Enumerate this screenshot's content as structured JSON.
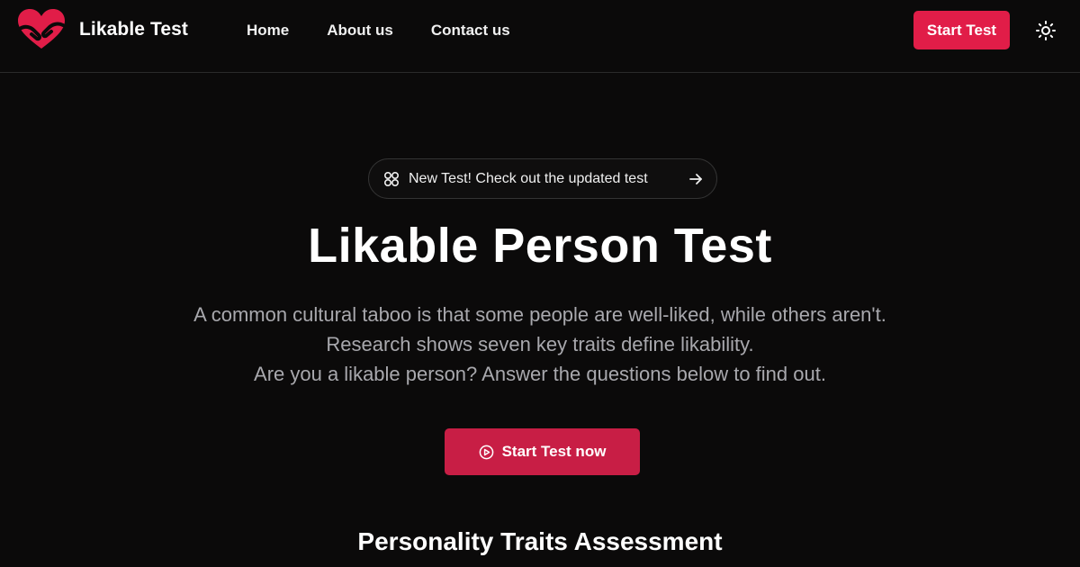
{
  "header": {
    "brand_name": "Likable Test",
    "logo_icon": "heart-hands-logo",
    "nav": [
      {
        "label": "Home"
      },
      {
        "label": "About us"
      },
      {
        "label": "Contact us"
      }
    ],
    "cta_label": "Start Test",
    "theme_icon": "sun-icon"
  },
  "hero": {
    "announcement": {
      "icon": "shapes-icon",
      "text": "New Test! Check out the updated test",
      "arrow_icon": "arrow-right-icon"
    },
    "title": "Likable Person Test",
    "description_lines": [
      "A common cultural taboo is that some people are well-liked, while others aren't.",
      "Research shows seven key traits define likability.",
      "Are you a likable person? Answer the questions below to find out."
    ],
    "cta_label": "Start Test now",
    "cta_icon": "play-circle-icon"
  },
  "section": {
    "title": "Personality Traits Assessment"
  },
  "colors": {
    "background": "#0b0a0a",
    "accent": "#e11d48",
    "accent_dark": "#c81e45",
    "muted_text": "#a8a8ad"
  }
}
